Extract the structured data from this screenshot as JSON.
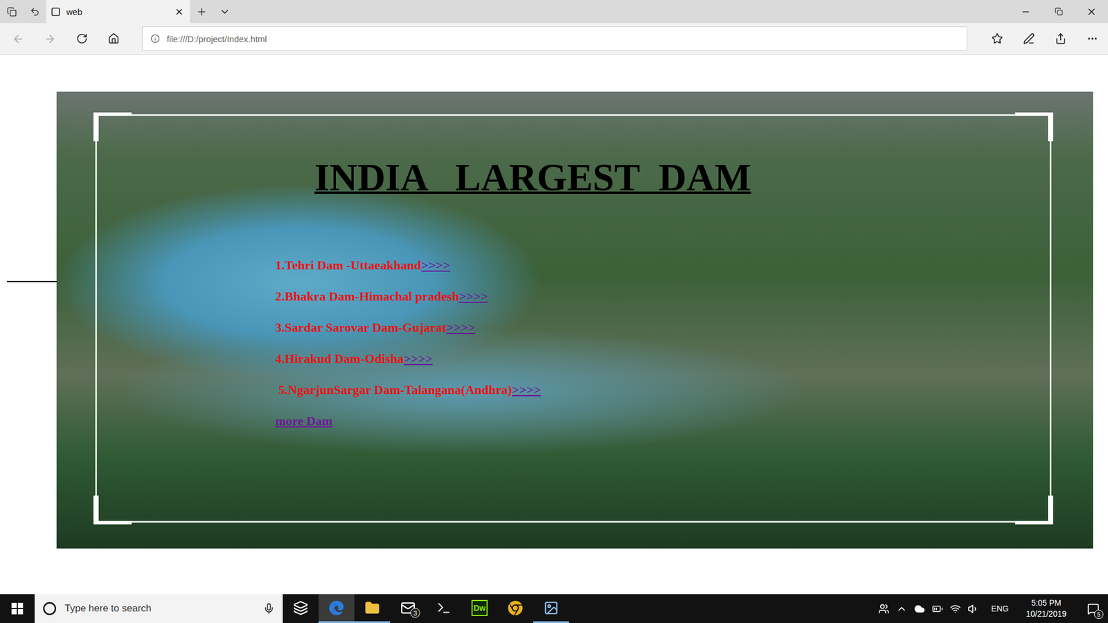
{
  "window": {
    "tab_title": "web",
    "address": "file:///D:/project/Index.html"
  },
  "page": {
    "heading": "INDIA   LARGEST  DAM",
    "links": [
      {
        "label": "1.Tehri Dam -Uttaeakhand",
        "link": ">>>>"
      },
      {
        "label": "2.Bhakra Dam-Himachal pradesh",
        "link": ">>>>"
      },
      {
        "label": "3.Sardar Sarovar Dam-Gujarat",
        "link": ">>>>"
      },
      {
        "label": "4.Hirakud Dam-Odisha",
        "link": ">>>>"
      },
      {
        "label": " 5.NgarjunSargar Dam-Talangana(Andhra)",
        "link": ">>>>"
      }
    ],
    "more": "more Dam"
  },
  "taskbar": {
    "search_placeholder": "Type here to search",
    "apps": [
      {
        "kind": "taskview",
        "running": false,
        "selected": false
      },
      {
        "kind": "edge",
        "running": true,
        "selected": true
      },
      {
        "kind": "explorer",
        "running": true,
        "selected": false
      },
      {
        "kind": "mail",
        "running": false,
        "selected": false,
        "badge": "3"
      },
      {
        "kind": "terminal",
        "running": false,
        "selected": false
      },
      {
        "kind": "dreamweaver",
        "running": false,
        "selected": false,
        "label": "Dw"
      },
      {
        "kind": "chrome",
        "running": false,
        "selected": false
      },
      {
        "kind": "photos",
        "running": true,
        "selected": false
      }
    ],
    "language": "ENG",
    "time": "5:05 PM",
    "date": "10/21/2019",
    "notification_badge": "5"
  }
}
